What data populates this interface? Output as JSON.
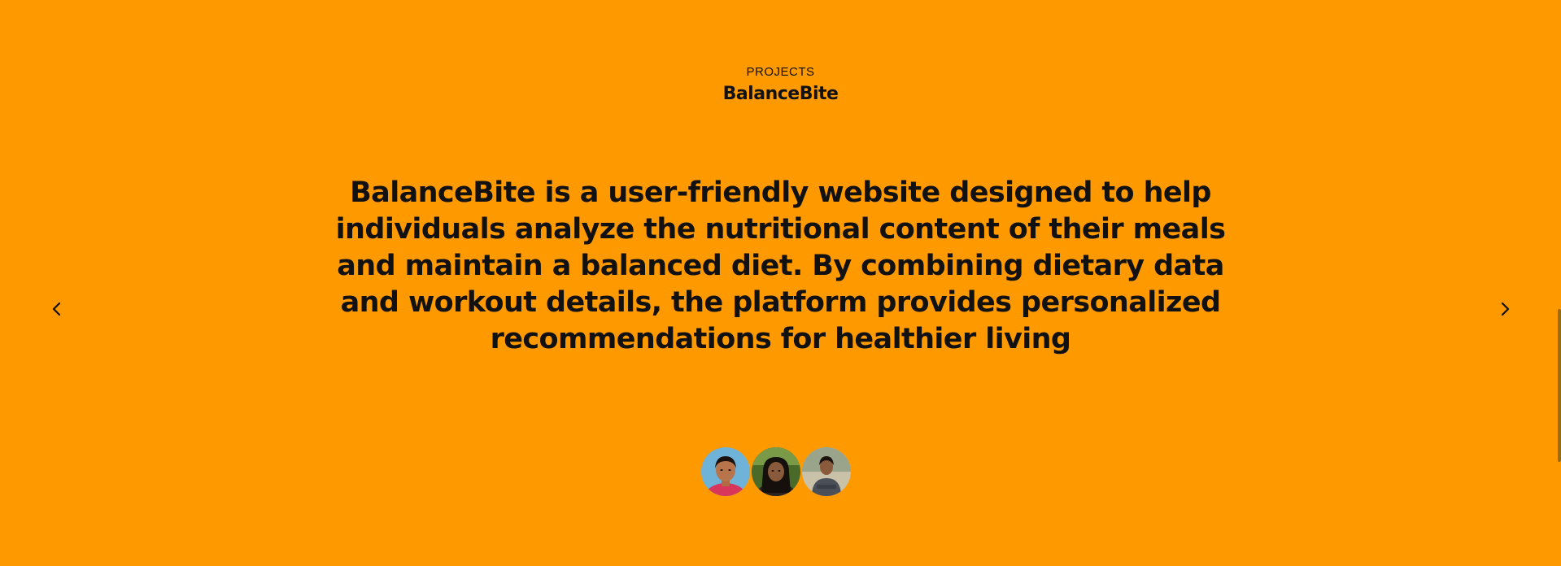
{
  "section": {
    "eyebrow": "PROJECTS",
    "title": "BalanceBite"
  },
  "project": {
    "description": "BalanceBite is a user-friendly website designed to help individuals analyze the nutritional content of their meals and maintain a balanced diet. By combining dietary data and workout details, the platform provides personalized recommendations for healthier living"
  },
  "navigation": {
    "prev_icon": "chevron-left-icon",
    "next_icon": "chevron-right-icon"
  },
  "team": {
    "avatars": [
      {
        "name": "avatar-1"
      },
      {
        "name": "avatar-2"
      },
      {
        "name": "avatar-3"
      }
    ]
  },
  "colors": {
    "background": "#FF9900",
    "text": "#111111"
  }
}
